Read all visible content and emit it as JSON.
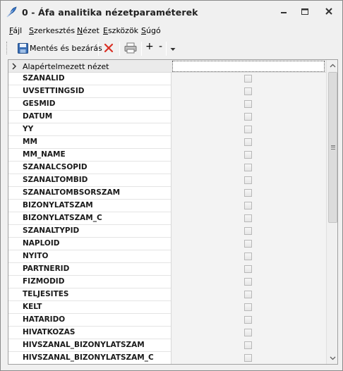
{
  "window": {
    "title": "0 - Áfa analitika nézetparaméterek",
    "app_icon": "feather-pen-icon",
    "controls": [
      "minimize-icon",
      "maximize-icon",
      "close-icon"
    ]
  },
  "menu": {
    "items": [
      {
        "label": "Fájl",
        "accel": "F"
      },
      {
        "label": "Szerkesztés",
        "accel": "S"
      },
      {
        "label": "Nézet",
        "accel": "N"
      },
      {
        "label": "Eszközök",
        "accel": "E"
      },
      {
        "label": "Súgó",
        "accel": "S"
      }
    ]
  },
  "toolbar": {
    "save_label": "Mentés és bezárás",
    "save_icon": "floppy-disk-icon",
    "delete_icon": "red-x-delete-icon",
    "print_icon": "printer-icon",
    "plus_label": "+",
    "minus_label": "-",
    "dropdown_icon": "chevron-down-icon"
  },
  "grid": {
    "header": {
      "label": "Alapértelmezett nézet",
      "value": ""
    },
    "rows": [
      {
        "name": "SZANALID",
        "checked": false
      },
      {
        "name": "UVSETTINGSID",
        "checked": false
      },
      {
        "name": "GESMID",
        "checked": false
      },
      {
        "name": "DATUM",
        "checked": false
      },
      {
        "name": "YY",
        "checked": false
      },
      {
        "name": "MM",
        "checked": false
      },
      {
        "name": "MM_NAME",
        "checked": false
      },
      {
        "name": "SZANALCSOPID",
        "checked": false
      },
      {
        "name": "SZANALTOMBID",
        "checked": false
      },
      {
        "name": "SZANALTOMBSORSZAM",
        "checked": false
      },
      {
        "name": "BIZONYLATSZAM",
        "checked": false
      },
      {
        "name": "BIZONYLATSZAM_C",
        "checked": false
      },
      {
        "name": "SZANALTYPID",
        "checked": false
      },
      {
        "name": "NAPLOID",
        "checked": false
      },
      {
        "name": "NYITO",
        "checked": false
      },
      {
        "name": "PARTNERID",
        "checked": false
      },
      {
        "name": "FIZMODID",
        "checked": false
      },
      {
        "name": "TELJESITES",
        "checked": false
      },
      {
        "name": "KELT",
        "checked": false
      },
      {
        "name": "HATARIDO",
        "checked": false
      },
      {
        "name": "HIVATKOZAS",
        "checked": false
      },
      {
        "name": "HIVSZANAL_BIZONYLATSZAM",
        "checked": false
      },
      {
        "name": "HIVSZANAL_BIZONYLATSZAM_C",
        "checked": false
      }
    ]
  },
  "colors": {
    "window_bg": "#f0f0f0",
    "grid_bg": "#ffffff",
    "value_cell_bg": "#f3f3f3",
    "delete_red": "#d93025"
  }
}
